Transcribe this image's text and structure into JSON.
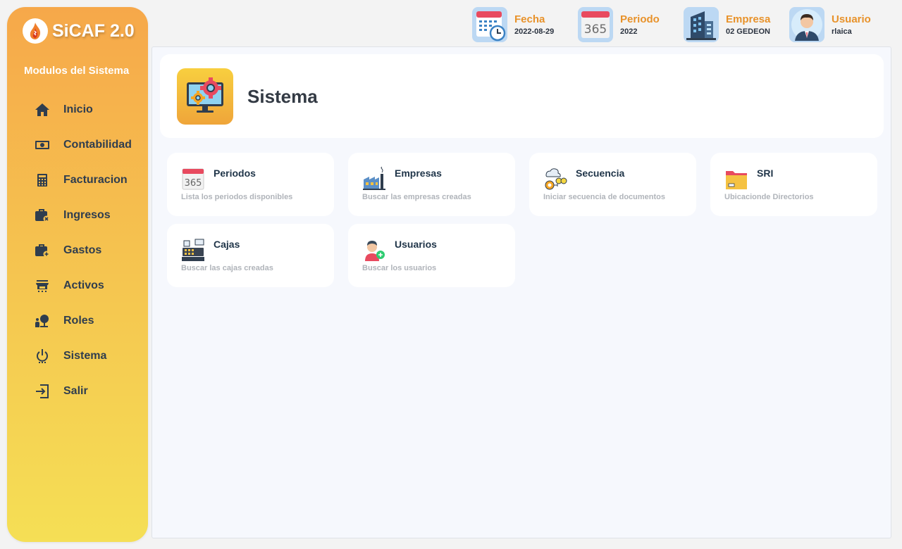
{
  "brand": {
    "title": "SiCAF 2.0"
  },
  "sidebar": {
    "section_title": "Modulos del Sistema",
    "items": [
      {
        "label": "Inicio",
        "icon": "home-icon"
      },
      {
        "label": "Contabilidad",
        "icon": "money-icon"
      },
      {
        "label": "Facturacion",
        "icon": "calculator-icon"
      },
      {
        "label": "Ingresos",
        "icon": "briefcase-x-icon"
      },
      {
        "label": "Gastos",
        "icon": "briefcase-plus-icon"
      },
      {
        "label": "Activos",
        "icon": "store-icon"
      },
      {
        "label": "Roles",
        "icon": "person-tree-icon"
      },
      {
        "label": "Sistema",
        "icon": "power-icon"
      },
      {
        "label": "Salir",
        "icon": "exit-icon"
      }
    ]
  },
  "header": {
    "fecha": {
      "label": "Fecha",
      "value": "2022-08-29",
      "icon": "calendar-clock-icon"
    },
    "periodo": {
      "label": "Periodo",
      "value": "2022",
      "icon": "calendar-365-icon"
    },
    "empresa": {
      "label": "Empresa",
      "value": "02 GEDEON",
      "icon": "building-icon"
    },
    "usuario": {
      "label": "Usuario",
      "value": "rlaica",
      "icon": "user-avatar-icon"
    }
  },
  "page": {
    "title": "Sistema",
    "icon": "monitor-gears-icon"
  },
  "cards": [
    {
      "title": "Periodos",
      "desc": "Lista los periodos disponibles",
      "icon": "calendar-365-icon"
    },
    {
      "title": "Empresas",
      "desc": "Buscar las empresas creadas",
      "icon": "factory-icon"
    },
    {
      "title": "Secuencia",
      "desc": "Iniciar secuencia de documentos",
      "icon": "sequence-icon"
    },
    {
      "title": "SRI",
      "desc": "Ubicacionde Directorios",
      "icon": "folder-icon"
    },
    {
      "title": "Cajas",
      "desc": "Buscar las cajas creadas",
      "icon": "cash-register-icon"
    },
    {
      "title": "Usuarios",
      "desc": "Buscar los usuarios",
      "icon": "user-add-icon"
    }
  ],
  "colors": {
    "accent": "#e8922a",
    "sidebar_top": "#f6a84a",
    "sidebar_bottom": "#f5df55",
    "text_dark": "#2f3d4e"
  }
}
